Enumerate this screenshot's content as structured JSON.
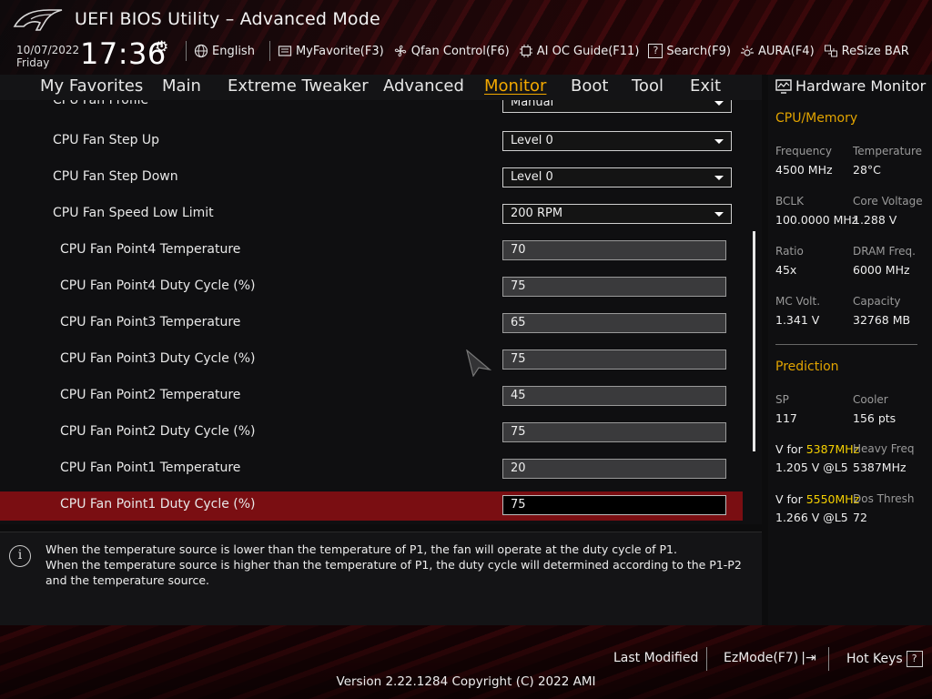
{
  "header": {
    "title": "UEFI BIOS Utility – Advanced Mode",
    "date": "10/07/2022",
    "day": "Friday",
    "time": "17:36",
    "toolbar": [
      {
        "label": "English",
        "icon": "globe-icon"
      },
      {
        "label": "MyFavorite(F3)",
        "icon": "favorite-list-icon"
      },
      {
        "label": "Qfan Control(F6)",
        "icon": "fan-icon"
      },
      {
        "label": "AI OC Guide(F11)",
        "icon": "chip-icon"
      },
      {
        "label": "Search(F9)",
        "icon": "search-help-icon"
      },
      {
        "label": "AURA(F4)",
        "icon": "aura-light-icon"
      },
      {
        "label": "ReSize BAR",
        "icon": "resize-bar-icon"
      }
    ]
  },
  "nav": {
    "items": [
      "My Favorites",
      "Main",
      "Extreme Tweaker",
      "Advanced",
      "Monitor",
      "Boot",
      "Tool",
      "Exit"
    ],
    "active": "Monitor"
  },
  "settings": [
    {
      "label": "CPU Fan Profile",
      "value": "Manual",
      "type": "dropdown"
    },
    {
      "label": "CPU Fan Step Up",
      "value": "Level 0",
      "type": "dropdown"
    },
    {
      "label": "CPU Fan Step Down",
      "value": "Level 0",
      "type": "dropdown"
    },
    {
      "label": "CPU Fan Speed Low Limit",
      "value": "200 RPM",
      "type": "dropdown"
    },
    {
      "label": "CPU Fan Point4 Temperature",
      "value": "70",
      "type": "field"
    },
    {
      "label": "CPU Fan Point4 Duty Cycle (%)",
      "value": "75",
      "type": "field"
    },
    {
      "label": "CPU Fan Point3 Temperature",
      "value": "65",
      "type": "field"
    },
    {
      "label": "CPU Fan Point3 Duty Cycle (%)",
      "value": "75",
      "type": "field"
    },
    {
      "label": "CPU Fan Point2 Temperature",
      "value": "45",
      "type": "field"
    },
    {
      "label": "CPU Fan Point2 Duty Cycle (%)",
      "value": "75",
      "type": "field"
    },
    {
      "label": "CPU Fan Point1 Temperature",
      "value": "20",
      "type": "field"
    },
    {
      "label": "CPU Fan Point1 Duty Cycle (%)",
      "value": "75",
      "type": "field",
      "selected": true
    }
  ],
  "help": {
    "line1": "When the temperature source is lower than the temperature of P1, the fan will operate at the duty cycle of P1.",
    "line2": "When the temperature source is higher than the temperature of P1, the duty cycle will determined according to the P1-P2 and the temperature source."
  },
  "hardware_monitor": {
    "title": "Hardware Monitor",
    "cpu_memory": {
      "section": "CPU/Memory",
      "frequency_label": "Frequency",
      "frequency": "4500 MHz",
      "temperature_label": "Temperature",
      "temperature": "28°C",
      "bclk_label": "BCLK",
      "bclk": "100.0000 MHz",
      "core_voltage_label": "Core Voltage",
      "core_voltage": "1.288 V",
      "ratio_label": "Ratio",
      "ratio": "45x",
      "dram_freq_label": "DRAM Freq.",
      "dram_freq": "6000 MHz",
      "mc_volt_label": "MC Volt.",
      "mc_volt": "1.341 V",
      "capacity_label": "Capacity",
      "capacity": "32768 MB"
    },
    "prediction": {
      "section": "Prediction",
      "sp_label": "SP",
      "sp": "117",
      "cooler_label": "Cooler",
      "cooler": "156 pts",
      "v_for_label": "V for ",
      "v1_freq": "5387MHz",
      "v1": "1.205 V @L5",
      "heavy_freq_label": "Heavy Freq",
      "heavy_freq": "5387MHz",
      "v2_freq": "5550MHz",
      "v2": "1.266 V @L5",
      "dos_thresh_label": "Dos Thresh",
      "dos_thresh": "72"
    }
  },
  "footer": {
    "last_modified": "Last Modified",
    "ezmode": "EzMode(F7)",
    "hotkeys": "Hot Keys",
    "version": "Version 2.22.1284 Copyright (C) 2022 AMI"
  },
  "colors": {
    "accent": "#f2a800",
    "selected_row": "#7a0e12",
    "highlight": "#f5d000"
  }
}
